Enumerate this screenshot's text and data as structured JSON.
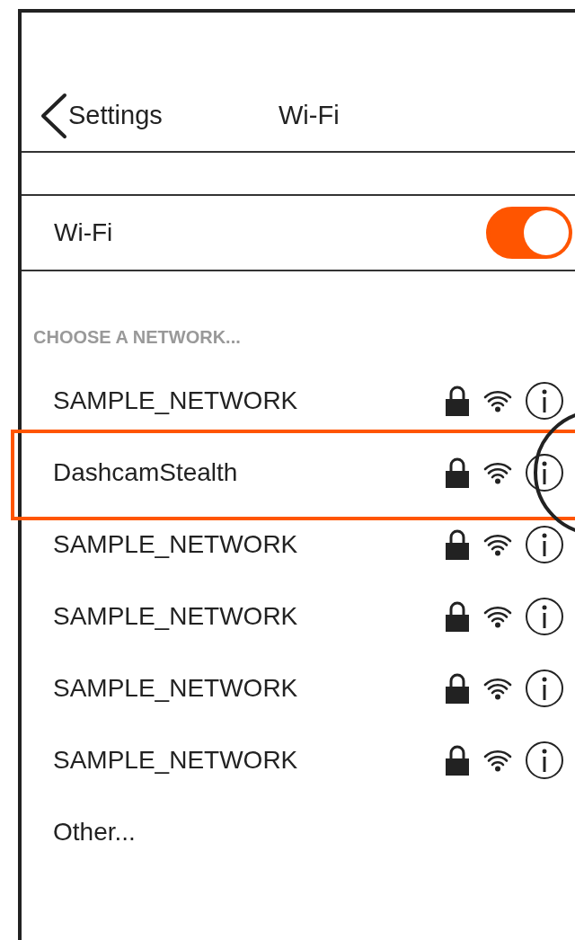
{
  "nav": {
    "back_label": "Settings",
    "title": "Wi-Fi"
  },
  "wifi": {
    "label": "Wi-Fi",
    "on": true
  },
  "section_header": "CHOOSE A NETWORK...",
  "networks": [
    {
      "name": "SAMPLE_NETWORK",
      "selected": false
    },
    {
      "name": "DashcamStealth",
      "selected": true
    },
    {
      "name": "SAMPLE_NETWORK",
      "selected": false
    },
    {
      "name": "SAMPLE_NETWORK",
      "selected": false
    },
    {
      "name": "SAMPLE_NETWORK",
      "selected": false
    },
    {
      "name": "SAMPLE_NETWORK",
      "selected": false
    }
  ],
  "other": "Other..."
}
